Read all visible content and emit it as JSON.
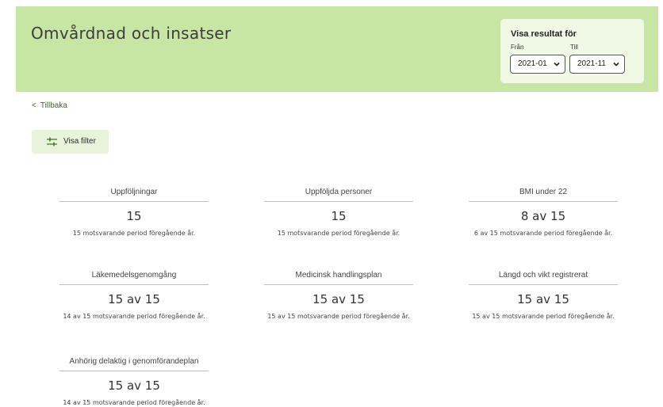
{
  "header": {
    "title": "Omvårdnad och insatser",
    "period": {
      "title": "Visa resultat för",
      "from_label": "Från",
      "to_label": "Till",
      "from_value": "2021-01",
      "to_value": "2021-11"
    }
  },
  "nav": {
    "back_arrow": "<",
    "back_label": "Tillbaka",
    "filter_label": "Visa filter",
    "filter_icon": "sliders-icon"
  },
  "colors": {
    "header_bg": "#c7e6a3",
    "period_box_bg": "#f0f8e6",
    "filter_button_bg": "#e7f4da",
    "link": "#3e6b1f"
  },
  "cards": [
    {
      "title": "Uppföljningar",
      "value": "15",
      "sub": "15 motsvarande period föregående år."
    },
    {
      "title": "Uppföljda personer",
      "value": "15",
      "sub": "15 motsvarande period föregående år."
    },
    {
      "title": "BMI under 22",
      "value": "8 av 15",
      "sub": "6 av 15 motsvarande period föregående år."
    },
    {
      "title": "Läkemedelsgenomgång",
      "value": "15 av 15",
      "sub": "14 av 15 motsvarande period föregående år."
    },
    {
      "title": "Medicinsk handlingsplan",
      "value": "15 av 15",
      "sub": "15 av 15 motsvarande period föregående år."
    },
    {
      "title": "Längd och vikt registrerat",
      "value": "15 av 15",
      "sub": "15 av 15 motsvarande period föregående år."
    },
    {
      "title": "Anhörig delaktig i genomförandeplan",
      "value": "15 av 15",
      "sub": "14 av 15 motsvarande period föregående år."
    }
  ]
}
